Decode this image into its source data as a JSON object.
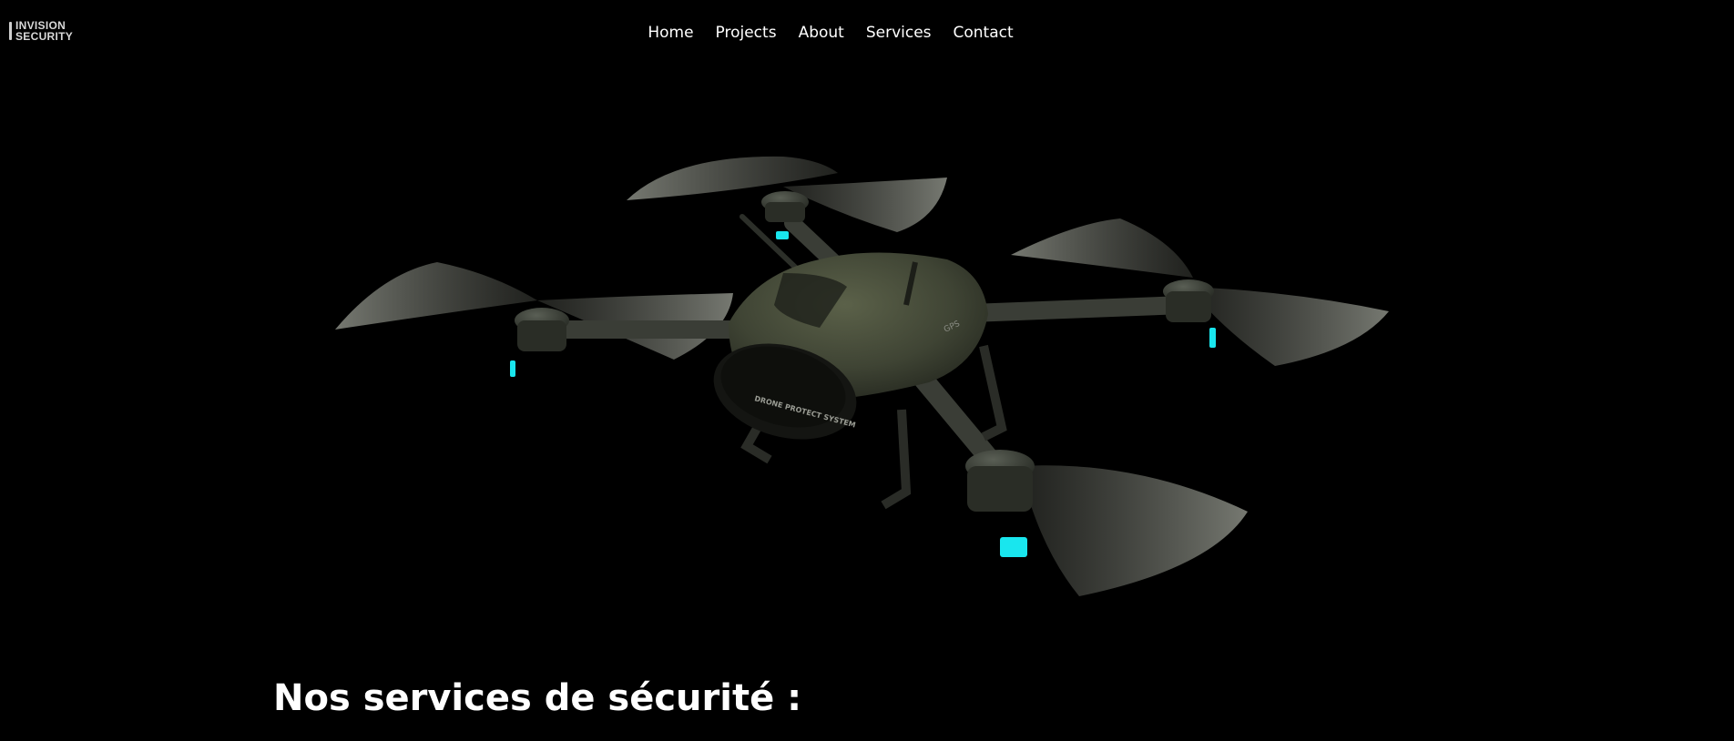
{
  "brand": {
    "line1": "INVISION",
    "line2": "SECURITY"
  },
  "nav": {
    "items": [
      {
        "label": "Home"
      },
      {
        "label": "Projects"
      },
      {
        "label": "About"
      },
      {
        "label": "Services"
      },
      {
        "label": "Contact"
      }
    ]
  },
  "hero": {
    "body_label": "DRONE PROTECT SYSTEM",
    "gps_label": "GPS",
    "colors": {
      "body": "#3f4434",
      "arms": "#3a3d36",
      "light": "#19e6ee",
      "blade": "#b9bcb2"
    }
  },
  "services": {
    "title": "Nos services de sécurité :"
  }
}
